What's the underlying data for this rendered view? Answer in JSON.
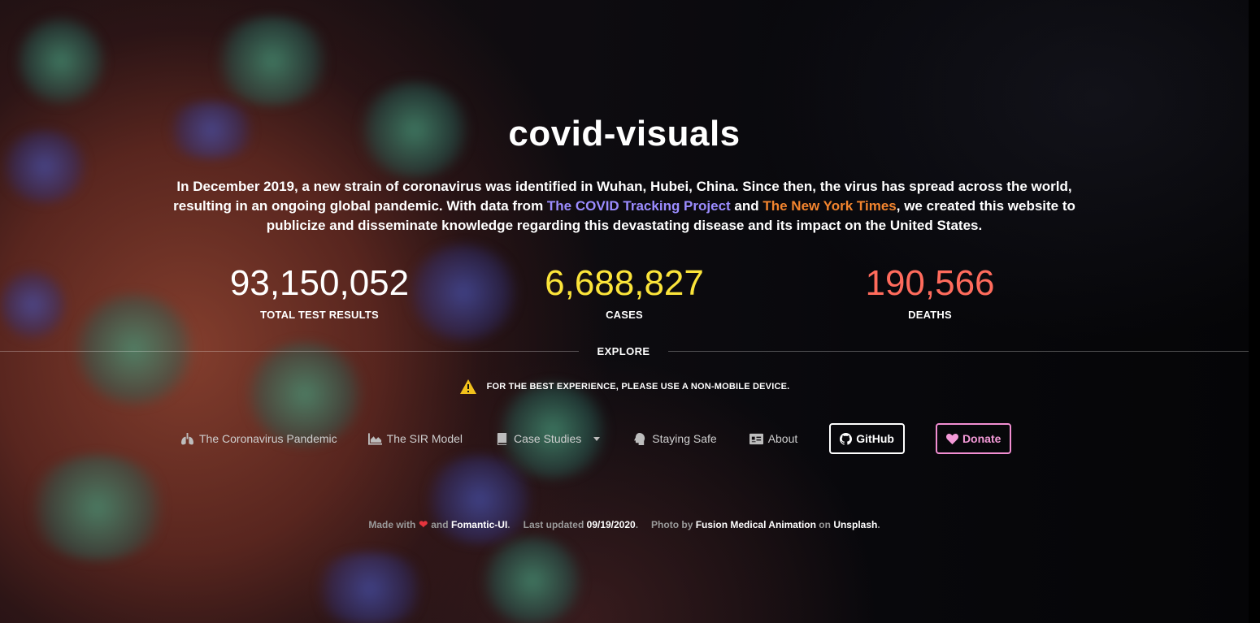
{
  "header": {
    "title": "covid-visuals"
  },
  "intro": {
    "part1": "In December 2019, a new strain of coronavirus was identified in Wuhan, Hubei, China. Since then, the virus has spread across the world, resulting in an ongoing global pandemic. With data from ",
    "link_covid": "The COVID Tracking Project",
    "part2": " and ",
    "link_nyt": "The New York Times",
    "part3": ", we created this website to publicize and disseminate knowledge regarding this devastating disease and its impact on the United States."
  },
  "stats": {
    "tests": {
      "value": "93,150,052",
      "label": "TOTAL TEST RESULTS"
    },
    "cases": {
      "value": "6,688,827",
      "label": "CASES"
    },
    "deaths": {
      "value": "190,566",
      "label": "DEATHS"
    }
  },
  "explore": {
    "label": "EXPLORE"
  },
  "warning": {
    "icon": "warning-icon",
    "text": "FOR THE BEST EXPERIENCE, PLEASE USE A NON-MOBILE DEVICE."
  },
  "nav": {
    "items": [
      {
        "label": "The Coronavirus Pandemic",
        "icon": "lungs-icon"
      },
      {
        "label": "The SIR Model",
        "icon": "area-chart-icon"
      },
      {
        "label": "Case Studies",
        "icon": "book-icon"
      },
      {
        "label": "Staying Safe",
        "icon": "head-side-icon"
      },
      {
        "label": "About",
        "icon": "id-card-icon"
      }
    ],
    "github_label": "GitHub",
    "donate_label": "Donate"
  },
  "footer": {
    "made_with": "Made with",
    "and": "and",
    "framework": "Fomantic-UI",
    "last_updated_label": "Last updated",
    "last_updated_date": "09/19/2020",
    "photo_by": "Photo by",
    "photographer": "Fusion Medical Animation",
    "on": "on",
    "source": "Unsplash"
  },
  "colors": {
    "cases": "#fbe43a",
    "deaths": "#ff6b5c",
    "covid_link": "#9b8cff",
    "nyt_link": "#f2842e",
    "donate": "#f49ad8"
  }
}
